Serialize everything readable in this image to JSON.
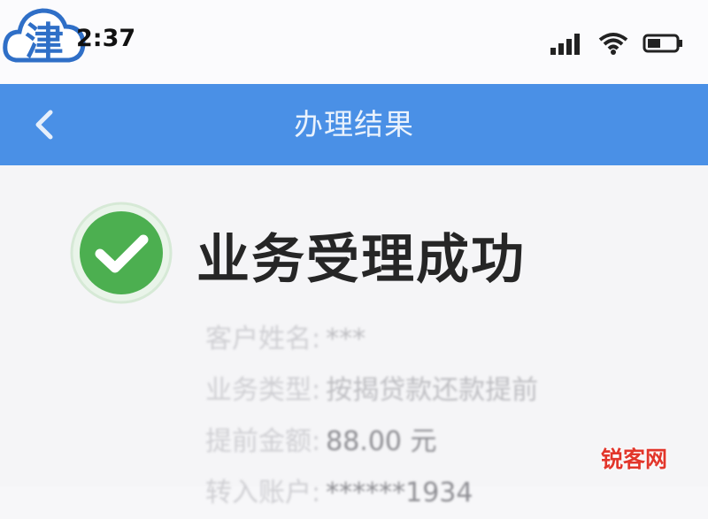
{
  "status_bar": {
    "time": "2:37",
    "icons": [
      "signal-icon",
      "wifi-icon",
      "battery-icon"
    ]
  },
  "logo": {
    "glyph": "津"
  },
  "nav": {
    "title": "办理结果",
    "back_icon": "chevron-left-icon"
  },
  "result": {
    "title": "业务受理成功",
    "icon": "check-circle-icon",
    "status_color": "#4caf50"
  },
  "details": [
    {
      "label": "客户姓名:",
      "value": "***"
    },
    {
      "label": "业务类型:",
      "value": "按揭贷款还款提前"
    },
    {
      "label": "提前金额:",
      "value": "88.00 元"
    },
    {
      "label": "转入账户:",
      "value": "******1934"
    }
  ],
  "watermark": "锐客网",
  "colors": {
    "nav_bg": "#4a90e6",
    "success": "#4caf50",
    "watermark": "#e2362b"
  }
}
